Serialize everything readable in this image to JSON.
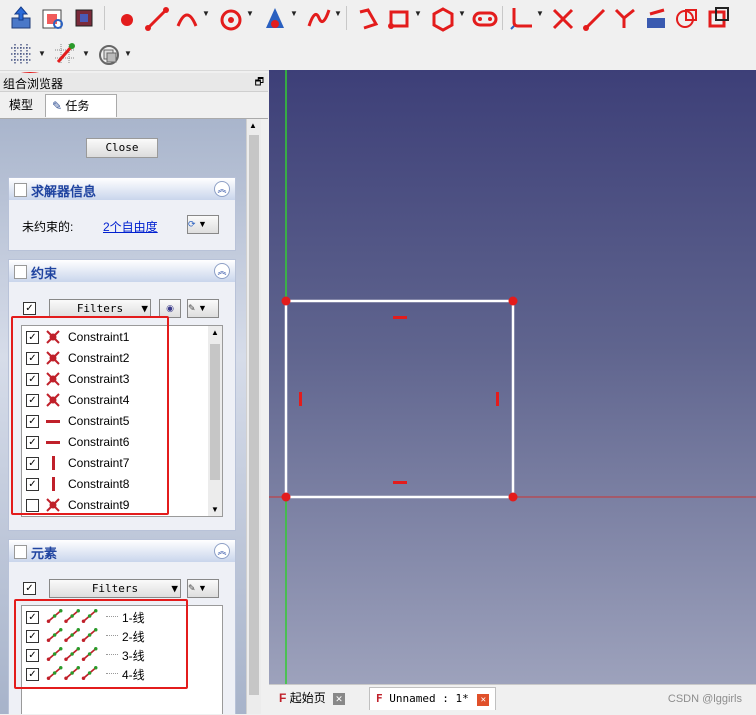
{
  "combo_view": {
    "title": "组合浏览器",
    "tabs": [
      "模型",
      "任务"
    ]
  },
  "task": {
    "close_label": "Close",
    "solver": {
      "title": "求解器信息",
      "label": "未约束的:",
      "link": "2个自由度"
    },
    "constraints": {
      "title": "约束",
      "filters_label": "Filters",
      "items": [
        {
          "name": "Constraint1",
          "type": "coincident",
          "checked": true
        },
        {
          "name": "Constraint2",
          "type": "coincident",
          "checked": true
        },
        {
          "name": "Constraint3",
          "type": "coincident",
          "checked": true
        },
        {
          "name": "Constraint4",
          "type": "coincident",
          "checked": true
        },
        {
          "name": "Constraint5",
          "type": "horizontal",
          "checked": true
        },
        {
          "name": "Constraint6",
          "type": "horizontal",
          "checked": true
        },
        {
          "name": "Constraint7",
          "type": "vertical",
          "checked": true
        },
        {
          "name": "Constraint8",
          "type": "vertical",
          "checked": true
        },
        {
          "name": "Constraint9",
          "type": "coincident",
          "checked": false
        }
      ]
    },
    "elements": {
      "title": "元素",
      "filters_label": "Filters",
      "items": [
        {
          "label": "1-线",
          "checked": true
        },
        {
          "label": "2-线",
          "checked": true
        },
        {
          "label": "3-线",
          "checked": true
        },
        {
          "label": "4-线",
          "checked": true
        }
      ]
    }
  },
  "bottom_tabs": [
    {
      "label": "起始页",
      "close": "✕"
    },
    {
      "label": "Unnamed : 1*",
      "close": "✕"
    }
  ],
  "watermark": "CSDN @lggirls",
  "colors": {
    "highlight_box": "#e31c1c",
    "sketch_line": "#ffffff",
    "sketch_point": "#e31c1c",
    "axis_v": "#33cc33",
    "axis_h": "#cc3333"
  }
}
